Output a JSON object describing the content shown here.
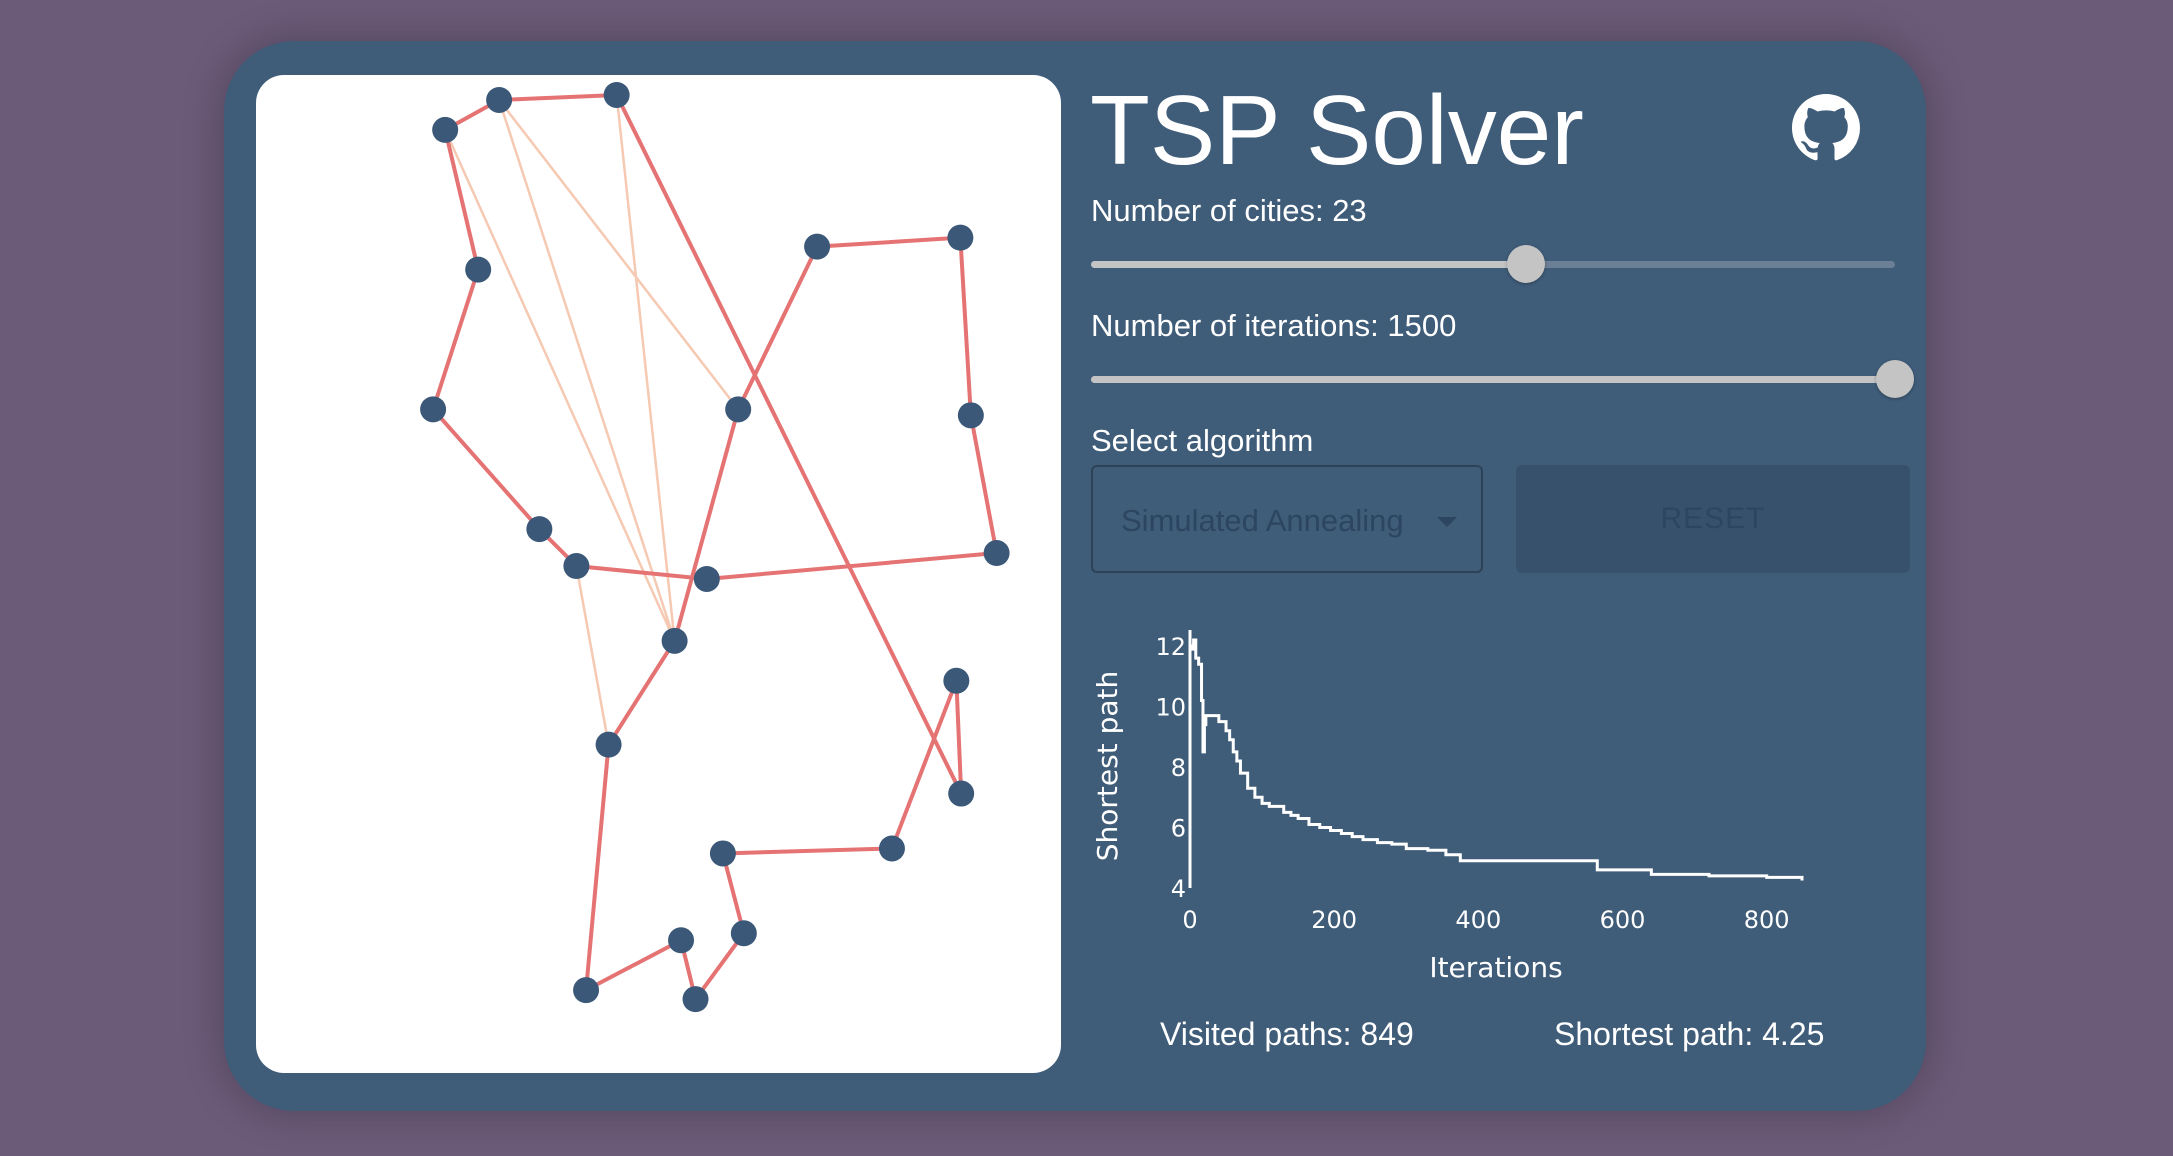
{
  "app": {
    "title": "TSP Solver",
    "github_icon": "github-icon"
  },
  "controls": {
    "cities": {
      "label_prefix": "Number of cities: ",
      "value": 23,
      "min": 3,
      "max": 40,
      "label": "Number of cities: 23"
    },
    "iterations": {
      "label_prefix": "Number of iterations: ",
      "value": 1500,
      "min": 0,
      "max": 1500,
      "label": "Number of iterations: 1500"
    },
    "algorithm": {
      "label": "Select algorithm",
      "selected": "Simulated Annealing"
    },
    "reset_label": "RESET"
  },
  "stats": {
    "visited": "Visited paths: 849",
    "shortest": "Shortest path: 4.25"
  },
  "colors": {
    "background": "#6b5a78",
    "card": "#3f5c79",
    "city": "#3b5878",
    "route": "#e57373",
    "faded_route": "#f5c9b2"
  },
  "tsp_map": {
    "cities": [
      [
        0.235,
        0.055
      ],
      [
        0.302,
        0.025
      ],
      [
        0.448,
        0.02
      ],
      [
        0.276,
        0.195
      ],
      [
        0.22,
        0.335
      ],
      [
        0.352,
        0.455
      ],
      [
        0.398,
        0.492
      ],
      [
        0.599,
        0.335
      ],
      [
        0.56,
        0.505
      ],
      [
        0.697,
        0.172
      ],
      [
        0.875,
        0.163
      ],
      [
        0.888,
        0.341
      ],
      [
        0.92,
        0.479
      ],
      [
        0.52,
        0.567
      ],
      [
        0.438,
        0.671
      ],
      [
        0.87,
        0.607
      ],
      [
        0.876,
        0.72
      ],
      [
        0.79,
        0.775
      ],
      [
        0.58,
        0.78
      ],
      [
        0.606,
        0.86
      ],
      [
        0.528,
        0.867
      ],
      [
        0.546,
        0.926
      ],
      [
        0.41,
        0.917
      ]
    ],
    "route": [
      0,
      1,
      2,
      16,
      15,
      17,
      18,
      19,
      21,
      20,
      22,
      14,
      13,
      7,
      9,
      10,
      11,
      12,
      8,
      6,
      5,
      4,
      3,
      0
    ],
    "faded_edges": [
      [
        0,
        13
      ],
      [
        1,
        7
      ],
      [
        1,
        13
      ],
      [
        2,
        13
      ],
      [
        6,
        14
      ]
    ]
  },
  "chart_data": {
    "type": "line",
    "xlabel": "Iterations",
    "ylabel": "Shortest path",
    "xlim": [
      0,
      849
    ],
    "ylim": [
      4,
      12.2
    ],
    "xticks": [
      0,
      200,
      400,
      600,
      800
    ],
    "yticks": [
      4,
      6,
      8,
      10,
      12
    ],
    "series": [
      {
        "x": [
          0,
          3,
          5,
          8,
          10,
          12,
          14,
          16,
          18,
          20,
          22,
          25,
          30,
          40,
          50,
          55,
          60,
          65,
          70,
          80,
          90,
          100,
          110,
          120,
          130,
          140,
          150,
          165,
          180,
          195,
          210,
          225,
          240,
          260,
          280,
          300,
          330,
          355,
          375,
          400,
          450,
          500,
          550,
          565,
          600,
          640,
          680,
          720,
          760,
          800,
          849
        ],
        "y": [
          12.0,
          11.9,
          12.2,
          11.6,
          11.6,
          11.4,
          11.4,
          10.2,
          8.5,
          9.4,
          9.7,
          9.7,
          9.7,
          9.5,
          9.2,
          8.9,
          8.5,
          8.2,
          7.8,
          7.3,
          7.0,
          6.8,
          6.7,
          6.7,
          6.5,
          6.4,
          6.3,
          6.1,
          6.0,
          5.9,
          5.8,
          5.7,
          5.6,
          5.5,
          5.45,
          5.3,
          5.25,
          5.1,
          4.9,
          4.9,
          4.9,
          4.9,
          4.9,
          4.6,
          4.6,
          4.45,
          4.45,
          4.4,
          4.4,
          4.35,
          4.25
        ]
      }
    ]
  }
}
